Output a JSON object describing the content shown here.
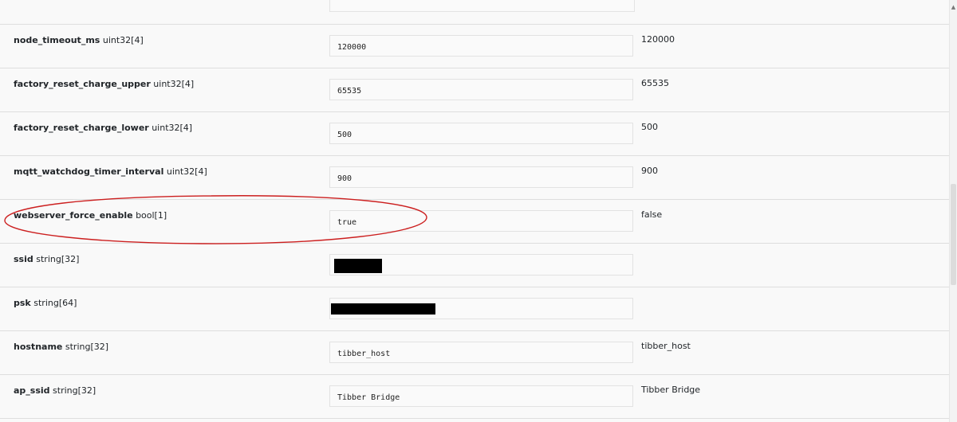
{
  "settings": {
    "rows": [
      {
        "name": "node_timeout_ms",
        "type": "uint32[4]",
        "input_value": "120000",
        "current_value": "120000"
      },
      {
        "name": "factory_reset_charge_upper",
        "type": "uint32[4]",
        "input_value": "65535",
        "current_value": "65535"
      },
      {
        "name": "factory_reset_charge_lower",
        "type": "uint32[4]",
        "input_value": "500",
        "current_value": "500"
      },
      {
        "name": "mqtt_watchdog_timer_interval",
        "type": "uint32[4]",
        "input_value": "900",
        "current_value": "900"
      },
      {
        "name": "webserver_force_enable",
        "type": "bool[1]",
        "input_value": "true",
        "current_value": "false"
      },
      {
        "name": "ssid",
        "type": "string[32]",
        "input_value": "",
        "current_value": ""
      },
      {
        "name": "psk",
        "type": "string[64]",
        "input_value": "",
        "current_value": ""
      },
      {
        "name": "hostname",
        "type": "string[32]",
        "input_value": "tibber_host",
        "current_value": "tibber_host"
      },
      {
        "name": "ap_ssid",
        "type": "string[32]",
        "input_value": "Tibber Bridge",
        "current_value": "Tibber Bridge"
      }
    ]
  },
  "annotation": {
    "highlight_color": "#cc1f1f"
  },
  "scrollbar": {
    "up_arrow_icon": "chevron-up-icon"
  },
  "colors": {
    "background": "#f9f9f9",
    "redaction": "#000000"
  }
}
